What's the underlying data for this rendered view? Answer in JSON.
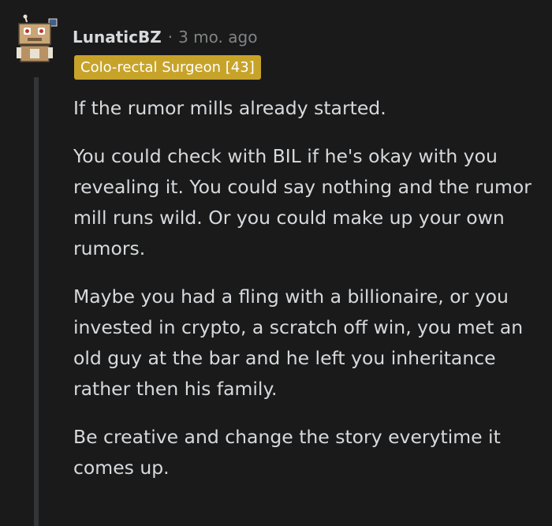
{
  "comment": {
    "username": "LunaticBZ",
    "separator": "·",
    "time_ago": "3 mo. ago",
    "flair": "Colo-rectal Surgeon [43]",
    "avatar_icon": "robot-snoo-avatar-icon",
    "colors": {
      "background": "#1a1a1b",
      "text": "#d7dadc",
      "muted": "#818384",
      "flair_bg": "#c7a32a",
      "thread_line": "#343536"
    },
    "paragraphs": [
      "If the rumor mills already started.",
      "You could check with BIL if he's okay with you revealing it. You could say nothing and the rumor mill runs wild. Or you could make up your own rumors.",
      "Maybe you had a fling with a billionaire, or you invested in crypto, a scratch off win, you met an old guy at the bar and he left you inheritance rather then his family.",
      "Be creative and change the story everytime it comes up."
    ]
  }
}
